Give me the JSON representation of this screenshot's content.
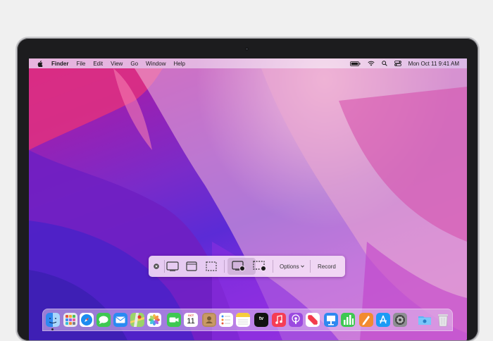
{
  "menubar": {
    "app_name": "Finder",
    "menus": [
      "File",
      "Edit",
      "View",
      "Go",
      "Window",
      "Help"
    ],
    "clock": "Mon Oct 11  9:41 AM"
  },
  "screenshot_toolbar": {
    "options_label": "Options",
    "record_label": "Record"
  },
  "dock": {
    "calendar_month": "OCT",
    "calendar_day": "11",
    "tv_label": "tv"
  },
  "colors": {
    "wallpaper_primary": "#b5179e",
    "wallpaper_secondary": "#5b2bd6",
    "record_dot": "#1a1a1a"
  }
}
